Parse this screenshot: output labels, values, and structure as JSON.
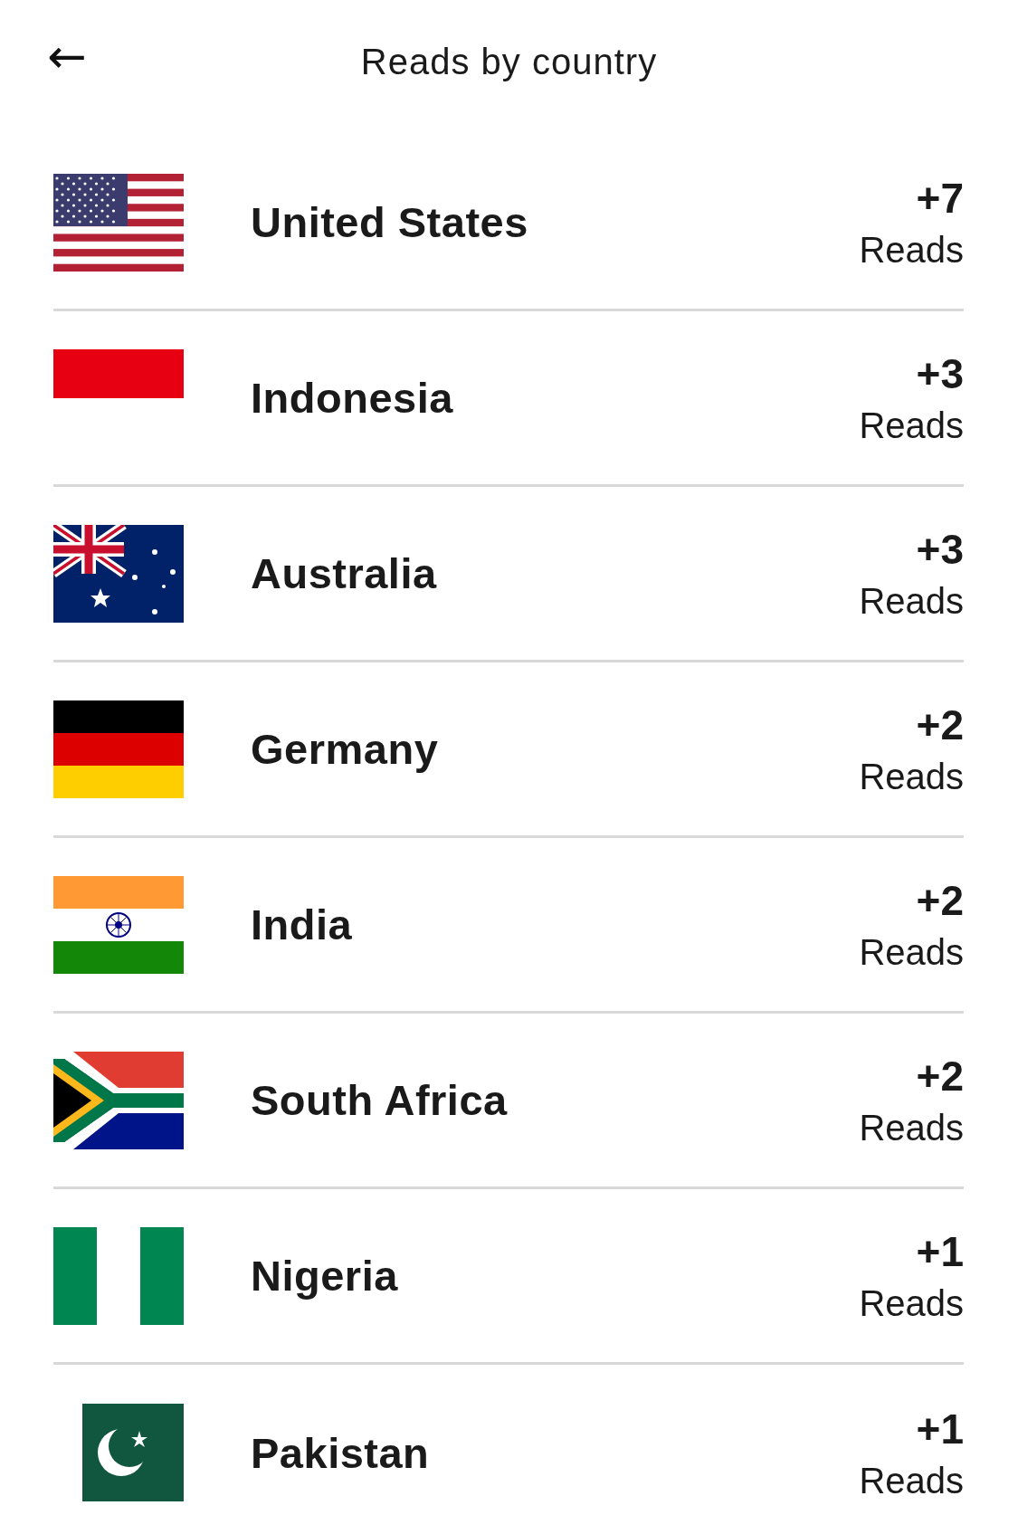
{
  "header": {
    "back_icon": "←",
    "title": "Reads by country"
  },
  "countries": [
    {
      "kind": "us",
      "name": "United States",
      "count": "+7",
      "unit": "Reads"
    },
    {
      "kind": "id",
      "name": "Indonesia",
      "count": "+3",
      "unit": "Reads"
    },
    {
      "kind": "au",
      "name": "Australia",
      "count": "+3",
      "unit": "Reads"
    },
    {
      "kind": "de",
      "name": "Germany",
      "count": "+2",
      "unit": "Reads"
    },
    {
      "kind": "in",
      "name": "India",
      "count": "+2",
      "unit": "Reads"
    },
    {
      "kind": "za",
      "name": "South Africa",
      "count": "+2",
      "unit": "Reads"
    },
    {
      "kind": "ng",
      "name": "Nigeria",
      "count": "+1",
      "unit": "Reads"
    },
    {
      "kind": "pk",
      "name": "Pakistan",
      "count": "+1",
      "unit": "Reads"
    }
  ]
}
